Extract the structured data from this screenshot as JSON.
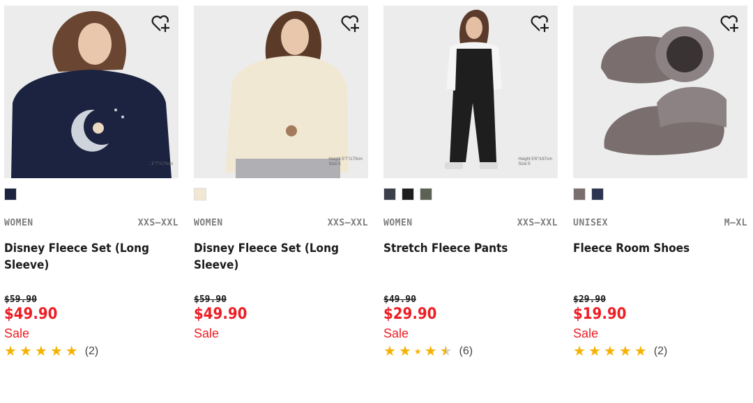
{
  "products": [
    {
      "photo_caption": "…5\"7\"/170cm",
      "swatch_colors": [
        "#1b2340"
      ],
      "gender": "WOMEN",
      "size_range": "XXS–XXL",
      "name": "Disney Fleece Set (Long Sleeve)",
      "original_price": "$59.90",
      "price": "$49.90",
      "sale_label": "Sale",
      "rating": 5,
      "review_count": "(2)"
    },
    {
      "photo_caption": "Height:5'7\"/170cm\nSize:S",
      "swatch_colors": [
        "#f1e8d4"
      ],
      "gender": "WOMEN",
      "size_range": "XXS–XXL",
      "name": "Disney Fleece Set (Long Sleeve)",
      "original_price": "$59.90",
      "price": "$49.90",
      "sale_label": "Sale",
      "rating": null,
      "review_count": null
    },
    {
      "photo_caption": "Height:5'6\"/167cm\nSize:S",
      "swatch_colors": [
        "#3b3f4a",
        "#1e1e1e",
        "#5d6256"
      ],
      "gender": "WOMEN",
      "size_range": "XXS–XXL",
      "name": "Stretch Fleece Pants",
      "original_price": "$49.90",
      "price": "$29.90",
      "sale_label": "Sale",
      "rating": 4.5,
      "review_count": "(6)"
    },
    {
      "photo_caption": "",
      "swatch_colors": [
        "#7a6e6f",
        "#2e3550"
      ],
      "gender": "UNISEX",
      "size_range": "M–XL",
      "name": "Fleece Room Shoes",
      "original_price": "$29.90",
      "price": "$19.90",
      "sale_label": "Sale",
      "rating": 5,
      "review_count": "(2)"
    }
  ],
  "icons": {
    "wishlist": "heart-plus-icon",
    "star": "star-icon"
  },
  "colors": {
    "sale_red": "#ed1d24",
    "star_gold": "#f6b200"
  }
}
